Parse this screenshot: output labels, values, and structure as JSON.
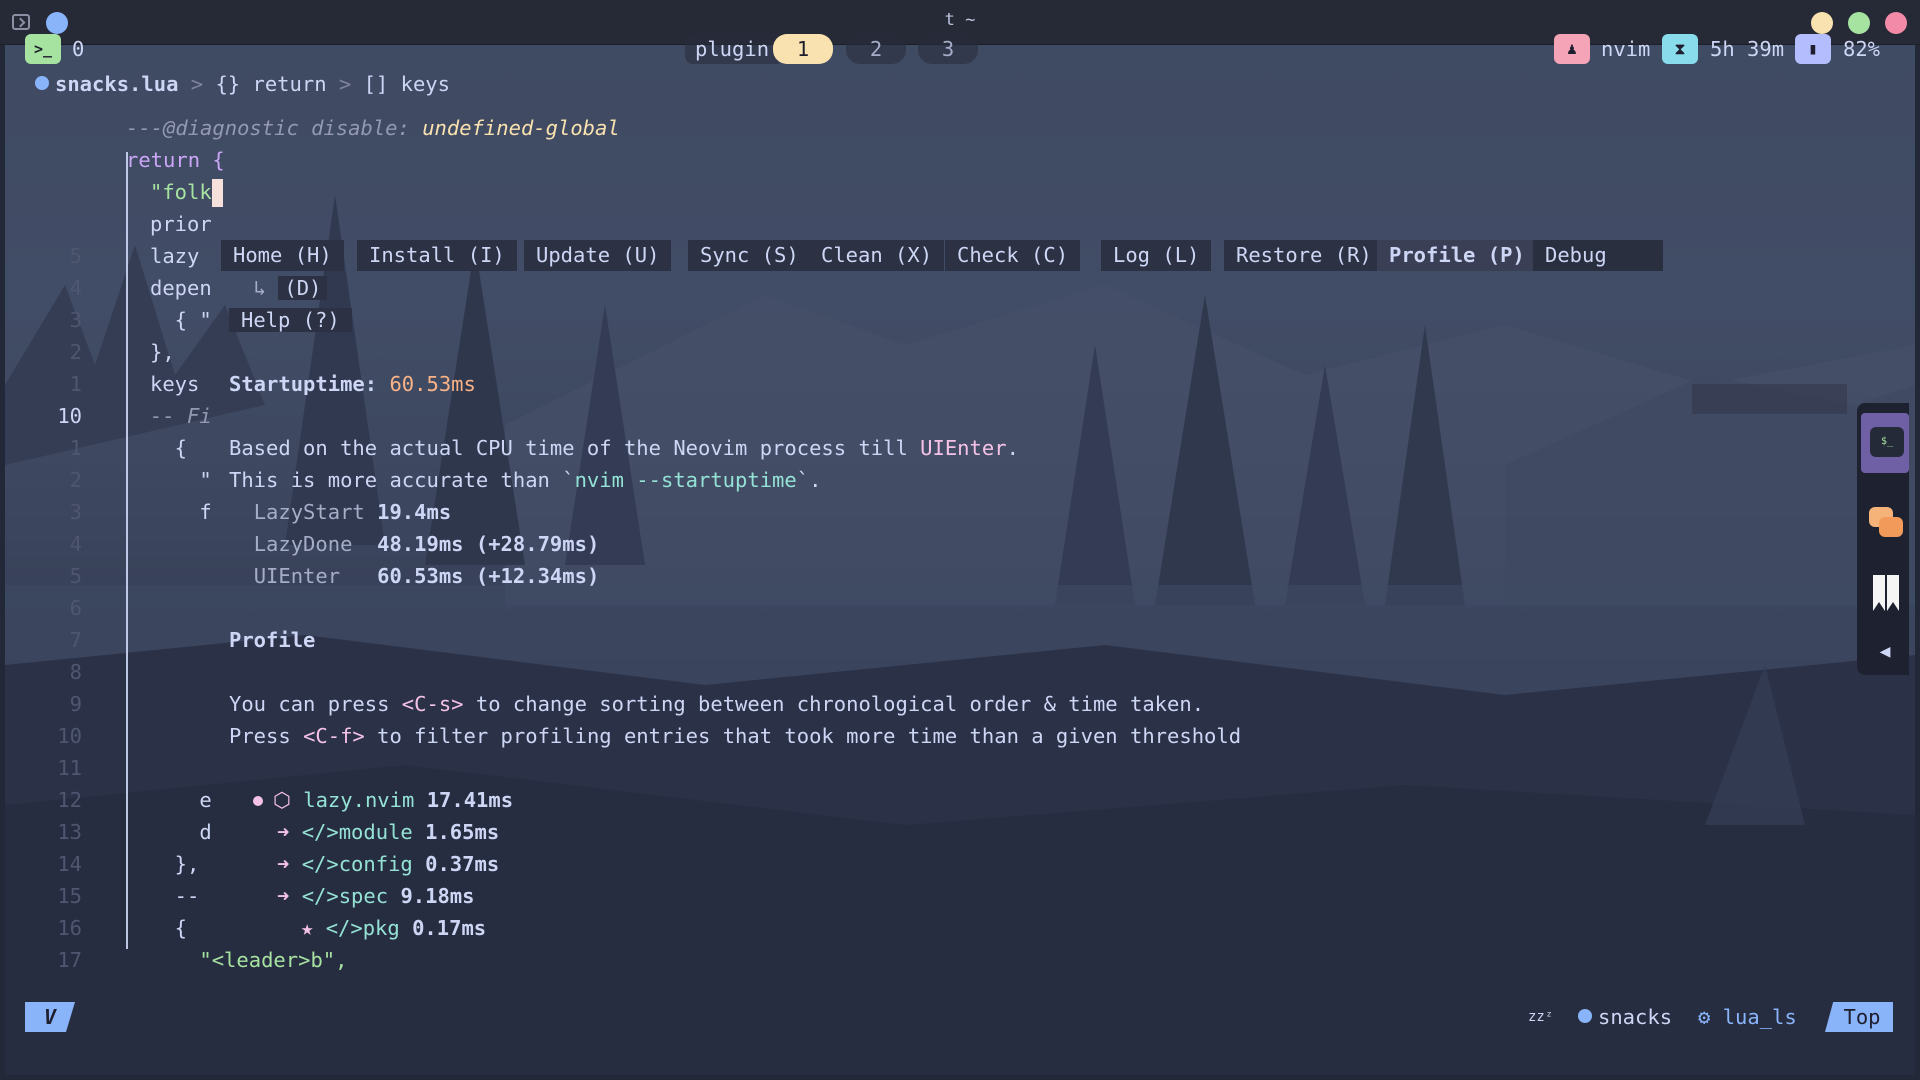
{
  "window": {
    "title": "t ~"
  },
  "topbar": {
    "terminal_badge": ">_",
    "workspace": "0",
    "tab_label": "plugin",
    "tabs": [
      "1",
      "2",
      "3"
    ],
    "user_app": "nvim",
    "elapsed": "5h 39m",
    "battery": "82%"
  },
  "breadcrumb": {
    "file": "snacks.lua",
    "sep": ">",
    "items": [
      "{} return",
      "[] keys"
    ]
  },
  "editor": {
    "lines": [
      {
        "ln": "",
        "code": "---@diagnostic disable: ",
        "extra": "undefined-global",
        "cls": "cmt"
      },
      {
        "ln": "",
        "code": "return {",
        "cls": "kw"
      },
      {
        "ln": "",
        "code": "\"folk",
        "cls": "str"
      },
      {
        "ln": "",
        "code": "prior",
        "cls": ""
      },
      {
        "ln": "5",
        "code": "lazy",
        "cls": ""
      },
      {
        "ln": "4",
        "code": "depen",
        "cls": ""
      },
      {
        "ln": "3",
        "code": "  { \"",
        "cls": ""
      },
      {
        "ln": "2",
        "code": "},",
        "cls": ""
      },
      {
        "ln": "1",
        "code": "keys",
        "cls": ""
      },
      {
        "ln": "10",
        "code": "-- Fi",
        "cls": "cmt"
      },
      {
        "ln": "1",
        "code": "  {",
        "cls": ""
      },
      {
        "ln": "2",
        "code": "    \"",
        "cls": ""
      },
      {
        "ln": "3",
        "code": "    f",
        "cls": ""
      },
      {
        "ln": "4",
        "code": "",
        "cls": ""
      },
      {
        "ln": "5",
        "code": "",
        "cls": ""
      },
      {
        "ln": "6",
        "code": "",
        "cls": ""
      },
      {
        "ln": "7",
        "code": "",
        "cls": ""
      },
      {
        "ln": "8",
        "code": "",
        "cls": ""
      },
      {
        "ln": "9",
        "code": "",
        "cls": ""
      },
      {
        "ln": "10",
        "code": "",
        "cls": ""
      },
      {
        "ln": "11",
        "code": "",
        "cls": ""
      },
      {
        "ln": "12",
        "code": "    e",
        "cls": ""
      },
      {
        "ln": "13",
        "code": "    d",
        "cls": ""
      },
      {
        "ln": "14",
        "code": "  },",
        "cls": ""
      },
      {
        "ln": "15",
        "code": "  --",
        "cls": ""
      },
      {
        "ln": "16",
        "code": "  {",
        "cls": ""
      },
      {
        "ln": "17",
        "code": "    \"<leader>b\",",
        "cls": "str"
      }
    ]
  },
  "lazy": {
    "buttons": [
      "Home (H)",
      "Install (I)",
      "Update (U)",
      "Sync (S)",
      "Clean (X)",
      "Check (C)",
      "Log (L)",
      "Restore (R)",
      "Profile (P)",
      "Debug"
    ],
    "debug_key": "(D)",
    "help": "Help (?)",
    "startup_label": "Startuptime:",
    "startup_value": "60.53ms",
    "desc1_a": "Based on the actual CPU time of the Neovim process till ",
    "desc1_b": "UIEnter",
    "desc1_c": ".",
    "desc2_a": "This is more accurate than `",
    "desc2_b": "nvim --startuptime",
    "desc2_c": "`.",
    "timings": [
      {
        "name": "LazyStart",
        "value": "19.4ms"
      },
      {
        "name": "LazyDone ",
        "value": "48.19ms (+28.79ms)"
      },
      {
        "name": "UIEnter  ",
        "value": "60.53ms (+12.34ms)"
      }
    ],
    "profile_heading": "Profile",
    "tip1_a": "You can press ",
    "tip1_key": "<C-s>",
    "tip1_b": " to change sorting between chronological order & time taken.",
    "tip2_a": "Press ",
    "tip2_key": "<C-f>",
    "tip2_b": " to filter profiling entries that took more time than a given threshold",
    "root": {
      "name": "lazy.nvim",
      "value": "17.41ms"
    },
    "children": [
      {
        "name": "module",
        "value": "1.65ms"
      },
      {
        "name": "config",
        "value": "0.37ms"
      },
      {
        "name": "spec",
        "value": "9.18ms"
      }
    ],
    "grandchild": {
      "name": "pkg",
      "value": "0.17ms"
    }
  },
  "statusline": {
    "mode": "V",
    "sleep": "zzᶻ",
    "plugin": "snacks",
    "lsp": "lua_ls",
    "position": "Top"
  },
  "colors": {
    "accent": "#89b4fa",
    "tab_active": "#f9e2af",
    "number": "#fab387",
    "highlight": "#f5c2e7"
  }
}
